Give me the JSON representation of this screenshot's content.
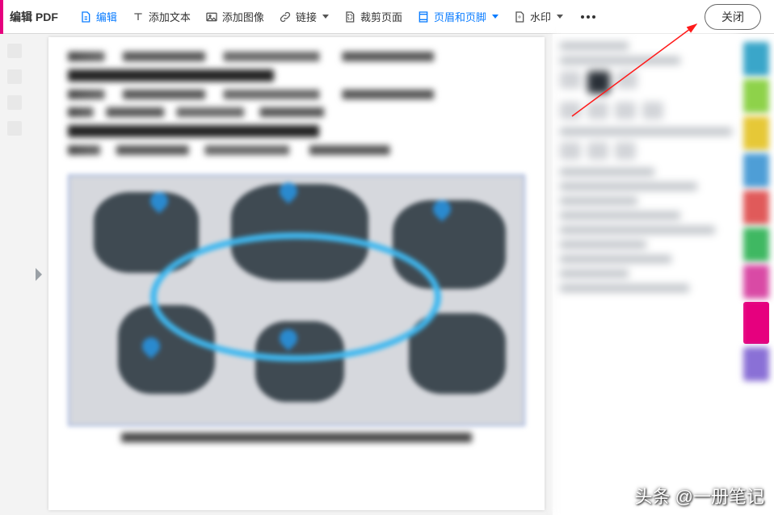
{
  "toolbar": {
    "title": "编辑 PDF",
    "edit": "编辑",
    "add_text": "添加文本",
    "add_image": "添加图像",
    "link": "链接",
    "crop_page": "裁剪页面",
    "header_footer": "页眉和页脚",
    "watermark": "水印",
    "close": "关闭"
  },
  "colors": {
    "accent_blue": "#0a7cff",
    "brand_pink": "#e6007e"
  },
  "rail_colors": [
    "#3aa6c9",
    "#8ed24a",
    "#e6c837",
    "#4e9ed6",
    "#e05a5a",
    "#3fb862",
    "#d94aa5",
    "#8a70d6"
  ],
  "watermark_text": "头条 @一册笔记",
  "icon_names": {
    "edit": "edit-document-icon",
    "text": "text-T-icon",
    "image": "image-icon",
    "link": "link-chain-icon",
    "crop": "crop-page-icon",
    "headerfooter": "header-footer-icon",
    "watermark": "watermark-icon",
    "more": "more-horizontal-icon"
  }
}
